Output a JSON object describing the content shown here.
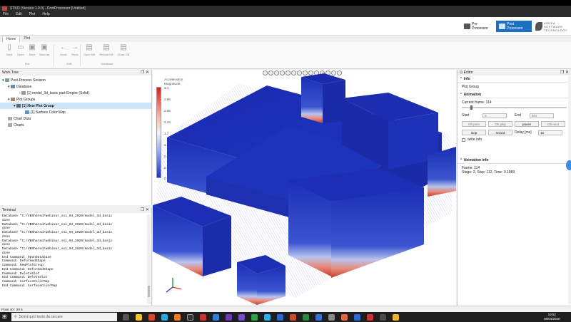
{
  "window": {
    "title": "STKO (Version 1.0.0) - PostProcessor [Untitled]"
  },
  "menu": [
    "File",
    "Edit",
    "Plot",
    "Help"
  ],
  "modes": {
    "pre": "Pre Processor",
    "post": "Post Processor"
  },
  "logo": {
    "line1": "ASDEA",
    "line2": "SOFTWARE",
    "line3": "TECHNOLOGY"
  },
  "ribbon": {
    "tabs": [
      "Home",
      "Plot"
    ],
    "file_buttons": [
      "New",
      "Open",
      "Save",
      "Save as"
    ],
    "edit_buttons": [
      "Undo",
      "Redo"
    ],
    "db_buttons": [
      "Open DB",
      "Reload DB",
      "Close DB"
    ],
    "groups": {
      "file": "File",
      "edit": "Edit",
      "database": "Database"
    }
  },
  "worktree": {
    "title": "Work Tree",
    "items": [
      "Post-Process Session",
      "Database",
      "[1] model_3d_basic part-Empire (Solid)",
      "Plot Groups",
      "[1] New Plot Group",
      "[1] Surface Color Map",
      "Chart Data",
      "Charts"
    ]
  },
  "terminal": {
    "title": "Terminal",
    "lines": [
      "Database \"C:/VBShared/webinar_ssi_04_2020/model_3d_basic",
      "done",
      "Database \"C:/VBShared/webinar_ssi_04_2020/model_3d_basic",
      "done",
      "Database \"C:/VBShared/webinar_ssi_04_2020/model_3d_basic",
      "done",
      "Database \"C:/VBShared/webinar_ssi_04_2020/model_3d_basic",
      "done",
      "Database \"C:/VBShared/webinar_ssi_04_2020/model_3d_basic",
      "done",
      "End Command: OpenDatabase",
      "Command: DeformedShape",
      "Command: NewPlotGroup",
      "End Command: DeformedShape",
      "Command: DeleteSlot",
      "End Command: DeleteSlot",
      "Command: SurfaceColorMap",
      "End Command: SurfaceColorMap"
    ]
  },
  "legend": {
    "title1": "Acceleration",
    "title2": "Magnitude",
    "ticks": [
      "3.4",
      "2.96",
      "2.55",
      "2.13",
      "1.7",
      "1.28",
      "0.85",
      "0.43",
      "0"
    ]
  },
  "editor": {
    "title": "Editor",
    "info_section": "Info",
    "info_value": "Plot Group",
    "animation_section": "Animation",
    "current_frame_label": "Current frame: 114",
    "start_label": "Start",
    "start_value": "0",
    "end_label": "End",
    "end_value": "601",
    "buttons": [
      "Oh prev",
      "Oh play",
      "pause",
      "Oh next",
      "stop",
      "record"
    ],
    "delay_label": "Delay [ms]",
    "delay_value": "10",
    "write_info_label": "write info",
    "animation_info_section": "Animation info",
    "frame_text": "Frame: 114",
    "stage_text": "Stage: 2, Step: 112, Time: 0.1083"
  },
  "status": {
    "point": "Point 40 : 20 5",
    "ready": "Pdn1"
  },
  "taskbar": {
    "search_placeholder": "Scrivi qui il testo da cercare",
    "time": "19:52",
    "date": "08/04/2020"
  }
}
